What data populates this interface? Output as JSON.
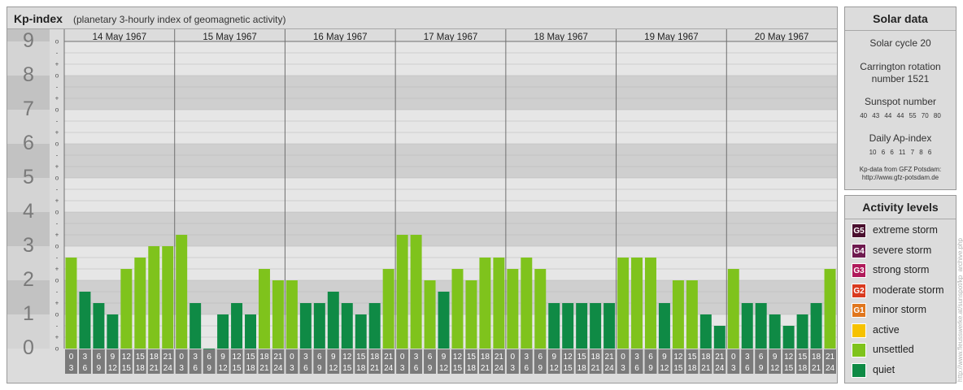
{
  "header": {
    "title": "Kp-index",
    "subtitle": "(planetary 3-hourly index of geomagnetic activity)"
  },
  "chart_data": {
    "type": "bar",
    "title": "Kp-index",
    "days": [
      "14 May 1967",
      "15 May 1967",
      "16 May 1967",
      "17 May 1967",
      "18 May 1967",
      "19 May 1967",
      "20 May 1967"
    ],
    "hour_labels": [
      [
        "0",
        "3"
      ],
      [
        "3",
        "6"
      ],
      [
        "6",
        "9"
      ],
      [
        "9",
        "12"
      ],
      [
        "12",
        "15"
      ],
      [
        "15",
        "18"
      ],
      [
        "18",
        "21"
      ],
      [
        "21",
        "24"
      ]
    ],
    "y_major_labels": [
      "0",
      "1",
      "2",
      "3",
      "4",
      "5",
      "6",
      "7",
      "8",
      "9"
    ],
    "y_minor_labels": [
      "o",
      "+",
      "-",
      "o",
      "+",
      "-",
      "o",
      "+",
      "-",
      "o",
      "+",
      "-",
      "o",
      "+",
      "-",
      "o",
      "+",
      "-",
      "o",
      "+",
      "-",
      "o",
      "+",
      "-",
      "o",
      "+",
      "-",
      "o"
    ],
    "ylim": [
      0,
      9
    ],
    "values": [
      2.667,
      1.667,
      1.333,
      1.0,
      2.333,
      2.667,
      3.0,
      3.0,
      3.333,
      1.333,
      0.0,
      1.0,
      1.333,
      1.0,
      2.333,
      2.0,
      2.0,
      1.333,
      1.333,
      1.667,
      1.333,
      1.0,
      1.333,
      2.333,
      3.333,
      3.333,
      2.0,
      1.667,
      2.333,
      2.0,
      2.667,
      2.667,
      2.333,
      2.667,
      2.333,
      1.333,
      1.333,
      1.333,
      1.333,
      1.333,
      2.667,
      2.667,
      2.667,
      1.333,
      2.0,
      2.0,
      1.0,
      0.667,
      2.333,
      1.333,
      1.333,
      1.0,
      0.667,
      1.0,
      1.333,
      2.333
    ],
    "colors": {
      "unsettled": "#7fc31c",
      "quiet": "#0f8a45"
    }
  },
  "solar": {
    "title": "Solar data",
    "cycle": "Solar cycle 20",
    "carrington_line1": "Carrington rotation",
    "carrington_line2": "number 1521",
    "sunspot_title": "Sunspot number",
    "sunspot_values": "40 43 44 44 55 70 80",
    "ap_title": "Daily Ap-index",
    "ap_values": "10 6 6 11 7 8 6",
    "source_line1": "Kp-data from GFZ Potsdam:",
    "source_line2": "http://www.gfz-potsdam.de"
  },
  "activity": {
    "title": "Activity levels",
    "levels": [
      {
        "code": "G5",
        "label": "extreme storm",
        "color": "#4a0f2e"
      },
      {
        "code": "G4",
        "label": "severe storm",
        "color": "#6e1a4f"
      },
      {
        "code": "G3",
        "label": "strong storm",
        "color": "#b0195a"
      },
      {
        "code": "G2",
        "label": "moderate storm",
        "color": "#d93a1f"
      },
      {
        "code": "G1",
        "label": "minor storm",
        "color": "#e0761d"
      },
      {
        "code": "",
        "label": "active",
        "color": "#f6c200"
      },
      {
        "code": "",
        "label": "unsettled",
        "color": "#7fc31c"
      },
      {
        "code": "",
        "label": "quiet",
        "color": "#0f8a45"
      }
    ]
  },
  "credit": "http://www.fleusswerke.at/sunspot/kp_archive.php"
}
